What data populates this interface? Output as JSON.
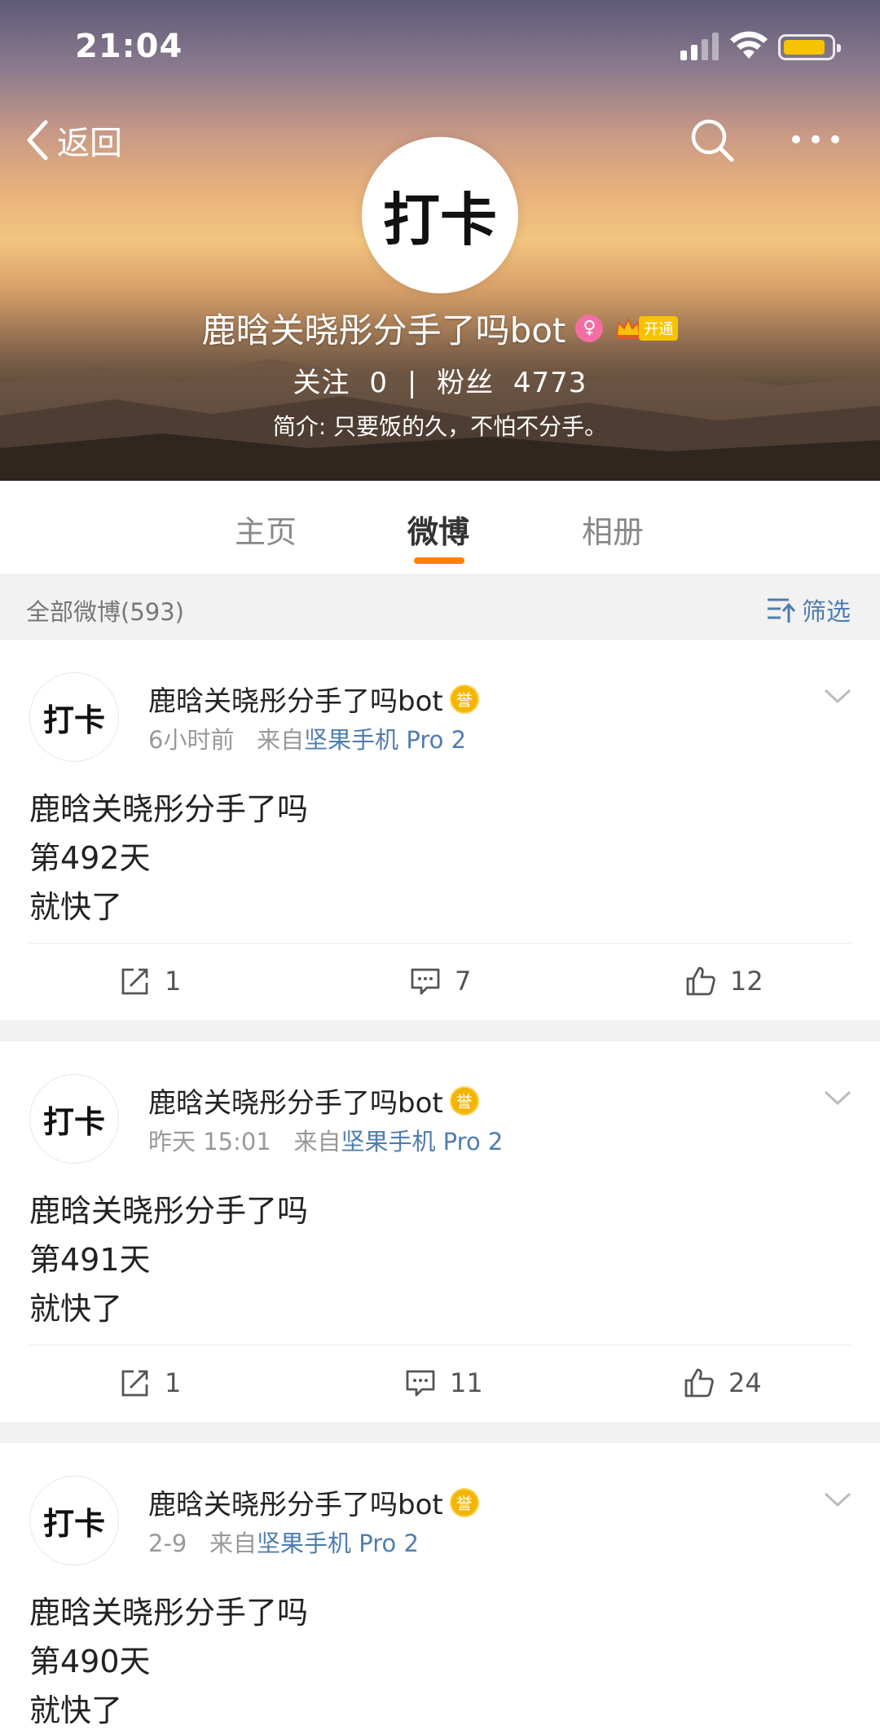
{
  "status_bar": {
    "time": "21:04"
  },
  "nav": {
    "back_label": "返回"
  },
  "profile": {
    "avatar_text": "打卡",
    "name": "鹿晗关晓彤分手了吗bot",
    "vip_label": "开通",
    "following_label": "关注",
    "following_count": "0",
    "separator": "|",
    "followers_label": "粉丝",
    "followers_count": "4773",
    "bio": "简介: 只要饭的久，不怕不分手。"
  },
  "tabs": [
    {
      "label": "主页"
    },
    {
      "label": "微博"
    },
    {
      "label": "相册"
    }
  ],
  "filter": {
    "count_label": "全部微博(593)",
    "filter_label": "筛选"
  },
  "posts": [
    {
      "avatar_text": "打卡",
      "author": "鹿晗关晓彤分手了吗bot",
      "time": "6小时前",
      "from_label": "来自",
      "source": "坚果手机 Pro 2",
      "lines": [
        "鹿晗关晓彤分手了吗",
        "第492天",
        "就快了"
      ],
      "reposts": "1",
      "comments": "7",
      "likes": "12"
    },
    {
      "avatar_text": "打卡",
      "author": "鹿晗关晓彤分手了吗bot",
      "time": "昨天 15:01",
      "from_label": "来自",
      "source": "坚果手机 Pro 2",
      "lines": [
        "鹿晗关晓彤分手了吗",
        "第491天",
        "就快了"
      ],
      "reposts": "1",
      "comments": "11",
      "likes": "24"
    },
    {
      "avatar_text": "打卡",
      "author": "鹿晗关晓彤分手了吗bot",
      "time": "2-9",
      "from_label": "来自",
      "source": "坚果手机 Pro 2",
      "lines": [
        "鹿晗关晓彤分手了吗",
        "第490天",
        "就快了"
      ]
    }
  ],
  "colors": {
    "accent": "#ff8200",
    "link": "#507daf",
    "vip_gold": "#f7c300"
  }
}
